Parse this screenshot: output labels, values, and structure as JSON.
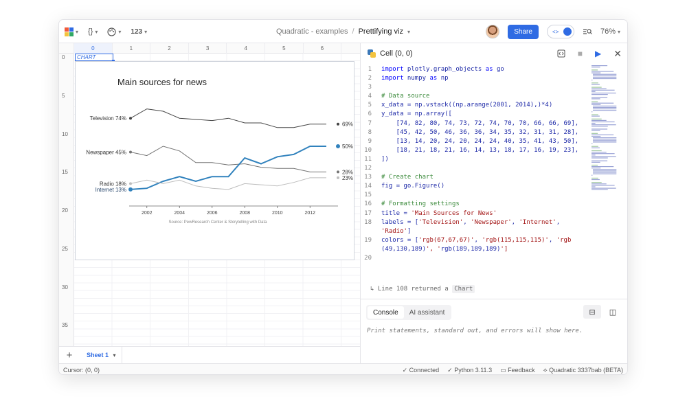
{
  "toolbar": {
    "formula_btn": "{}",
    "number_btn": "123",
    "file_path": "Quadratic - examples",
    "separator": "/",
    "file_name": "Prettifying viz",
    "share_label": "Share",
    "toggle_glyph": "<>",
    "zoom": "76%"
  },
  "logo_colors": [
    "#f05a3a",
    "#2f6be3",
    "#f3c33f",
    "#31a865"
  ],
  "grid": {
    "columns": [
      "0",
      "1",
      "2",
      "3",
      "4",
      "5",
      "6"
    ],
    "rows": [
      "0",
      "5",
      "10",
      "15",
      "20",
      "25",
      "30",
      "35"
    ],
    "chart_cell_label": "CHART"
  },
  "chart_data": {
    "type": "line",
    "title": "Main sources for news",
    "source_note": "Source: PewResearch Center & Storytelling with Data",
    "x": [
      2001,
      2002,
      2003,
      2004,
      2005,
      2006,
      2007,
      2008,
      2009,
      2010,
      2011,
      2012,
      2013
    ],
    "xticks": [
      2002,
      2004,
      2006,
      2008,
      2010,
      2012
    ],
    "ylim": [
      0,
      100
    ],
    "grid": false,
    "series": [
      {
        "name": "Television",
        "color": "#434343",
        "width": 1,
        "values": [
          74,
          82,
          80,
          74,
          73,
          72,
          74,
          70,
          70,
          66,
          66,
          69,
          69
        ],
        "start_label": "Television 74%",
        "end_label": "69%"
      },
      {
        "name": "Newspaper",
        "color": "#737373",
        "width": 1,
        "values": [
          45,
          42,
          50,
          46,
          36,
          36,
          34,
          35,
          32,
          31,
          31,
          28,
          28
        ],
        "start_label": "Newspaper 45%",
        "end_label": "28%"
      },
      {
        "name": "Internet",
        "color": "#3182bd",
        "width": 2,
        "values": [
          13,
          14,
          20,
          24,
          20,
          24,
          24,
          40,
          35,
          41,
          43,
          50,
          50
        ],
        "start_label": "Internet 13%",
        "end_label": "50%"
      },
      {
        "name": "Radio",
        "color": "#bdbdbd",
        "width": 1,
        "values": [
          18,
          21,
          18,
          21,
          16,
          14,
          13,
          18,
          17,
          16,
          19,
          23,
          23
        ],
        "start_label": "Radio 18%",
        "end_label": "23%"
      }
    ]
  },
  "sheet": {
    "add": "+",
    "tab": "Sheet 1"
  },
  "status": {
    "cursor": "Cursor: (0, 0)",
    "connected": "✓ Connected",
    "python": "✓ Python 3.11.3",
    "feedback": "Feedback",
    "version": "Quadratic 3337bab (BETA)"
  },
  "editor": {
    "title": "Cell (0, 0)",
    "lines": [
      "import plotly.graph_objects as go",
      "import numpy as np",
      "",
      "# Data source",
      "x_data = np.vstack((np.arange(2001, 2014),)*4)",
      "y_data = np.array([",
      "    [74, 82, 80, 74, 73, 72, 74, 70, 70, 66, 66, 69],",
      "    [45, 42, 50, 46, 36, 36, 34, 35, 32, 31, 31, 28],",
      "    [13, 14, 20, 24, 20, 24, 24, 40, 35, 41, 43, 50],",
      "    [18, 21, 18, 21, 16, 14, 13, 18, 17, 16, 19, 23],",
      "])",
      "",
      "# Create chart",
      "fig = go.Figure()",
      "",
      "# Formatting settings",
      "title = 'Main Sources for News'",
      "labels = ['Television', 'Newspaper', 'Internet',",
      "'Radio']",
      "colors = ['rgb(67,67,67)', 'rgb(115,115,115)', 'rgb",
      "(49,130,189)', 'rgb(189,189,189)']",
      ""
    ],
    "line_numbers": [
      "1",
      "2",
      "3",
      "4",
      "5",
      "6",
      "7",
      "8",
      "9",
      "10",
      "11",
      "12",
      "13",
      "14",
      "15",
      "16",
      "17",
      "18",
      "",
      "19",
      "",
      "20"
    ],
    "returned_prefix": "↳   Line 108 returned a",
    "returned_type": "Chart"
  },
  "console": {
    "tab_console": "Console",
    "tab_ai": "AI assistant",
    "message": "Print statements, standard out, and errors will show here."
  }
}
